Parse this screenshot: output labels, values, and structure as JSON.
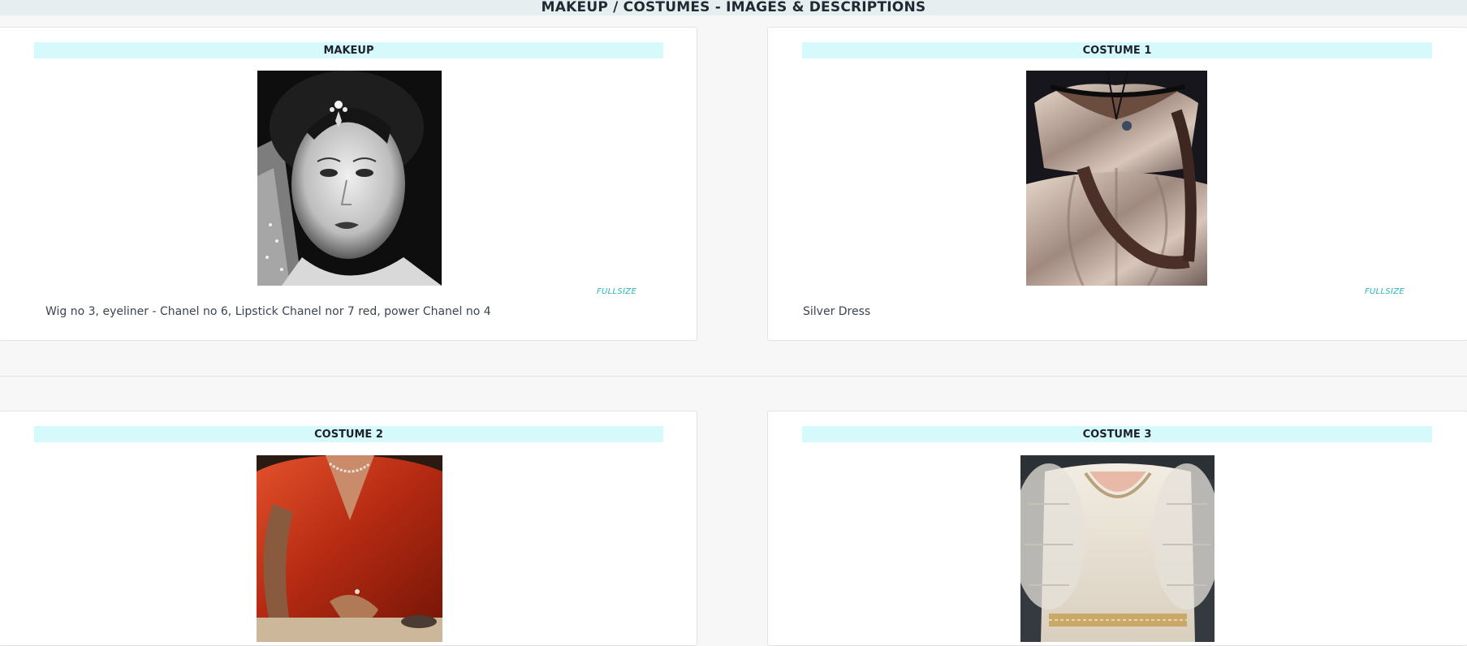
{
  "page": {
    "title": "MAKEUP / COSTUMES - IMAGES & DESCRIPTIONS"
  },
  "cards": [
    {
      "header": "MAKEUP",
      "image_subject": "black-and-white portrait of a woman wearing a jeweled headpiece",
      "fullsize_label": "FULLSIZE",
      "description": "Wig no 3, eyeliner - Chanel no 6, Lipstick Chanel nor 7 red, power Chanel no 4"
    },
    {
      "header": "COSTUME 1",
      "image_subject": "silver satin dress with dark lace neckline",
      "fullsize_label": "FULLSIZE",
      "description": "Silver Dress"
    },
    {
      "header": "COSTUME 2",
      "image_subject": "red satin blouse with pearl necklace",
      "fullsize_label": "",
      "description": ""
    },
    {
      "header": "COSTUME 3",
      "image_subject": "white lace dress with sheer puffed sleeves",
      "fullsize_label": "",
      "description": ""
    }
  ],
  "colors": {
    "header_band": "#d6f9fc",
    "link": "#2bb3c0",
    "top_bar": "#e6eef0"
  }
}
